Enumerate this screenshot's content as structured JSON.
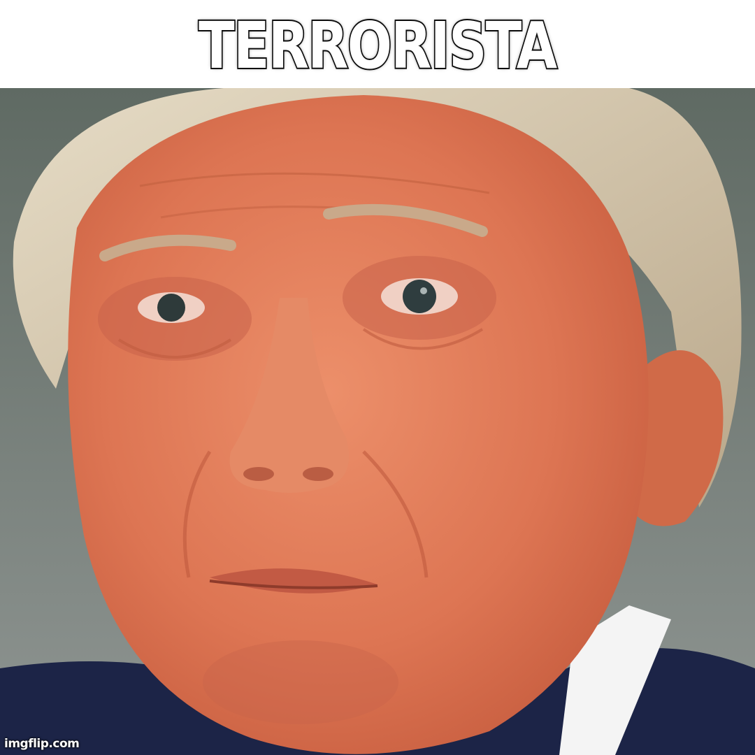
{
  "meme": {
    "caption": "TERRORISTA",
    "watermark": "imgflip.com"
  },
  "colors": {
    "background": "#ffffff",
    "caption_fill": "#ffffff",
    "caption_outline": "#111111",
    "skin": "#e07a58",
    "hair": "#d9cbb4",
    "suit": "#1c2447",
    "shirt": "#f4f4f4"
  },
  "photo": {
    "subject": "close-up-face"
  }
}
